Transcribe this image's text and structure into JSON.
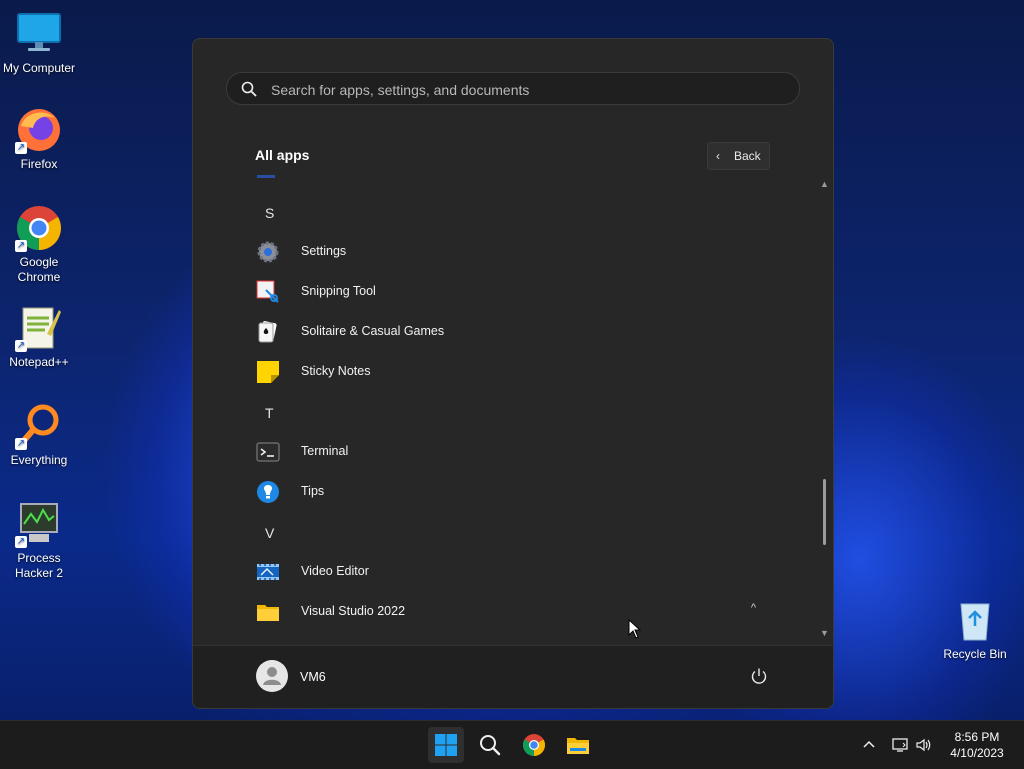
{
  "desktop": {
    "icons": [
      {
        "label": "My Computer"
      },
      {
        "label": "Firefox"
      },
      {
        "label": "Google Chrome"
      },
      {
        "label": "Notepad++"
      },
      {
        "label": "Everything"
      },
      {
        "label": "Process Hacker 2"
      }
    ],
    "recycle_bin": {
      "label": "Recycle Bin"
    }
  },
  "start_menu": {
    "search_placeholder": "Search for apps, settings, and documents",
    "all_apps_title": "All apps",
    "back_label": "Back",
    "letters": {
      "s": "S",
      "t": "T",
      "v": "V"
    },
    "apps": [
      {
        "label": "Settings",
        "icon": "gear-icon"
      },
      {
        "label": "Snipping Tool",
        "icon": "snipping-tool-icon"
      },
      {
        "label": "Solitaire & Casual Games",
        "icon": "cards-icon"
      },
      {
        "label": "Sticky Notes",
        "icon": "sticky-note-icon"
      },
      {
        "label": "Terminal",
        "icon": "terminal-icon"
      },
      {
        "label": "Tips",
        "icon": "lightbulb-icon"
      },
      {
        "label": "Video Editor",
        "icon": "film-icon"
      },
      {
        "label": "Visual Studio 2022",
        "icon": "folder-icon"
      }
    ],
    "user": {
      "name": "VM6"
    }
  },
  "taskbar": {
    "time": "8:56 PM",
    "date": "4/10/2023"
  },
  "colors": {
    "accent": "#1a73e8",
    "menu_bg": "#272727",
    "taskbar_bg": "#1c1c1c"
  }
}
